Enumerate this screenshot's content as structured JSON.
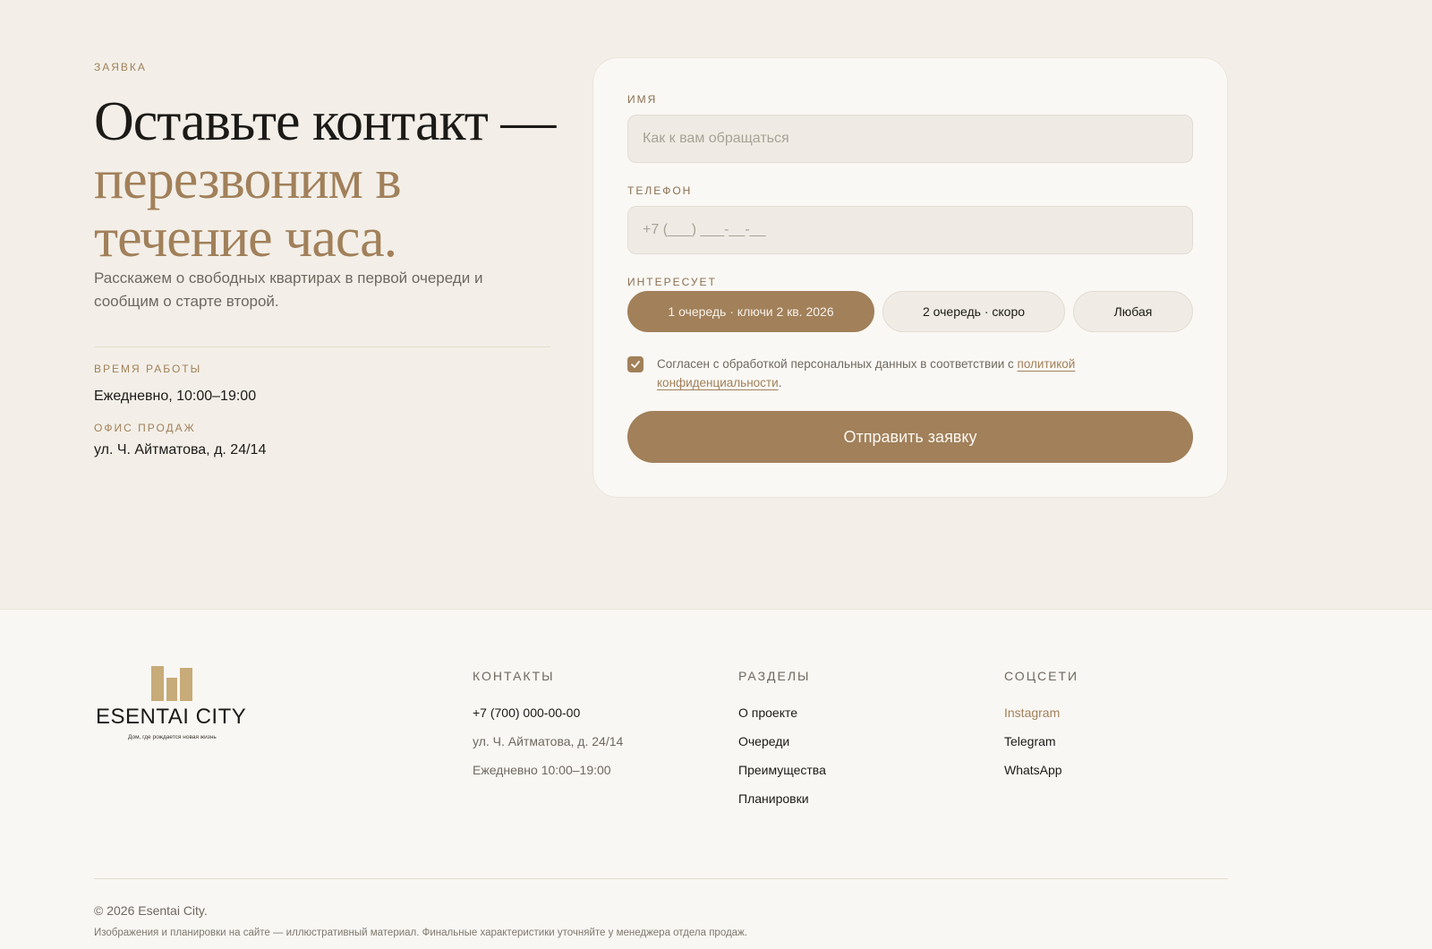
{
  "request": {
    "eyebrow": "Заявка",
    "headline_line1": "Оставьте контакт —",
    "headline_line2": "перезвоним в",
    "headline_line3": "течение часа.",
    "lead": "Расскажем о свободных квартирах в первой очереди и сообщим о старте второй.",
    "hours_label": "Время работы",
    "hours_value": "Ежедневно, 10:00–19:00",
    "office_label": "Офис продаж",
    "office_value": "ул. Ч. Айтматова, д. 24/14"
  },
  "form": {
    "name_label": "Имя",
    "name_placeholder": "Как к вам обращаться",
    "name_value": "",
    "phone_label": "Телефон",
    "phone_placeholder": "+7 (___) ___-__-__",
    "phone_value": "",
    "interest_label": "Интересует",
    "options": [
      {
        "label": "1 очередь · ключи 2 кв. 2026",
        "selected": true
      },
      {
        "label": "2 очередь · скоро",
        "selected": false
      },
      {
        "label": "Любая",
        "selected": false
      }
    ],
    "consent_checked": true,
    "consent_text": "Согласен с обработкой персональных данных в соответствии с ",
    "consent_link": "политикой конфиденциальности",
    "consent_end": ".",
    "submit_label": "Отправить заявку"
  },
  "footer": {
    "logo_text": "ESENTAI CITY",
    "logo_tagline": "Дом, где рождается новая жизнь",
    "contacts_title": "Контакты",
    "contacts": [
      "+7 (700) 000-00-00",
      "ул. Ч. Айтматова, д. 24/14",
      "Ежедневно 10:00–19:00"
    ],
    "sections_title": "Разделы",
    "sections": [
      "О проекте",
      "Очереди",
      "Преимущества",
      "Планировки"
    ],
    "social_title": "Соцсети",
    "social": [
      "Instagram",
      "Telegram",
      "WhatsApp"
    ],
    "copyright": "© 2026 Esentai City.",
    "disclaimer": "Изображения и планировки на сайте — иллюстративный материал. Финальные характеристики уточняйте у менеджера отдела продаж."
  },
  "colors": {
    "accent": "#a1805a",
    "background": "#f3efe8",
    "footer_background": "#f9f7f3",
    "text": "#1c1a17"
  },
  "icons": {
    "consent_checkbox": "checkmark-icon",
    "logo": "building-bars-logo"
  }
}
